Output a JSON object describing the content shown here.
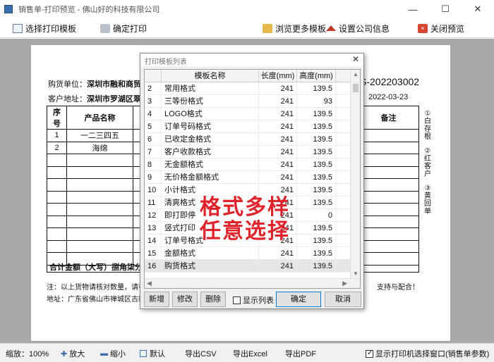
{
  "window": {
    "title": "销售单-打印预览 - 佛山好的科技有限公司",
    "controls": [
      "—",
      "☐",
      "✕"
    ]
  },
  "toolbar": {
    "select_template": "选择打印模板",
    "confirm_print": "确定打印",
    "browse_templates": "浏览更多模板",
    "company_info": "设置公司信息",
    "close_preview": "关闭预览"
  },
  "document": {
    "buyer_label": "购货单位：",
    "buyer_value": "深圳市融和商贸",
    "address_label": "客户地址：",
    "address_value": "深圳市罗湖区翠",
    "doc_no": "S-202203002",
    "date": "2022-03-23",
    "headers": [
      "序号",
      "产品名称",
      "备注"
    ],
    "rows": [
      {
        "no": "1",
        "name": "一二三四五"
      },
      {
        "no": "2",
        "name": "海绵"
      }
    ],
    "total_label": "合计金额（大写）捌角柒分",
    "note1": "注：以上货物请核对数量，请在",
    "note1_right": "支持与配合！",
    "note2": "地址：广东省佛山市禅城区古新",
    "side1": "①白存根",
    "side2": "②红客户",
    "side3": "③黄回单"
  },
  "dialog": {
    "title": "打印模板列表",
    "columns": [
      "模板名称",
      "长度(mm)",
      "高度(mm)"
    ],
    "rows": [
      {
        "idx": "2",
        "name": "常用格式",
        "len": "241",
        "hgt": "139.5"
      },
      {
        "idx": "3",
        "name": "三等份格式",
        "len": "241",
        "hgt": "93"
      },
      {
        "idx": "4",
        "name": "LOGO格式",
        "len": "241",
        "hgt": "139.5"
      },
      {
        "idx": "5",
        "name": "订单号码格式",
        "len": "241",
        "hgt": "139.5"
      },
      {
        "idx": "6",
        "name": "已收定金格式",
        "len": "241",
        "hgt": "139.5"
      },
      {
        "idx": "7",
        "name": "客户收款格式",
        "len": "241",
        "hgt": "139.5"
      },
      {
        "idx": "8",
        "name": "无金额格式",
        "len": "241",
        "hgt": "139.5"
      },
      {
        "idx": "9",
        "name": "无价格金额格式",
        "len": "241",
        "hgt": "139.5"
      },
      {
        "idx": "10",
        "name": "小计格式",
        "len": "241",
        "hgt": "139.5"
      },
      {
        "idx": "11",
        "name": "清爽格式",
        "len": "241",
        "hgt": "139.5"
      },
      {
        "idx": "12",
        "name": "即打即停",
        "len": "241",
        "hgt": "0"
      },
      {
        "idx": "13",
        "name": "竖式打印",
        "len": "241",
        "hgt": "139.5"
      },
      {
        "idx": "14",
        "name": "订单号格式",
        "len": "241",
        "hgt": "139.5"
      },
      {
        "idx": "15",
        "name": "金额格式",
        "len": "241",
        "hgt": "139.5"
      },
      {
        "idx": "16",
        "name": "购货格式",
        "len": "241",
        "hgt": "139.5"
      }
    ],
    "overlay_line1": "格式多样",
    "overlay_line2": "任意选择",
    "buttons": {
      "add": "新增",
      "edit": "修改",
      "delete": "删除",
      "show_columns": "显示列表",
      "ok": "确定",
      "cancel": "取消"
    }
  },
  "statusbar": {
    "zoom": "缩放：100%",
    "zoom_in": "放大",
    "zoom_out": "缩小",
    "default": "默认",
    "export_csv": "导出CSV",
    "export_excel": "导出Excel",
    "export_pdf": "导出PDF",
    "show_printer": "显示打印机选择窗口(销售单参数)"
  }
}
